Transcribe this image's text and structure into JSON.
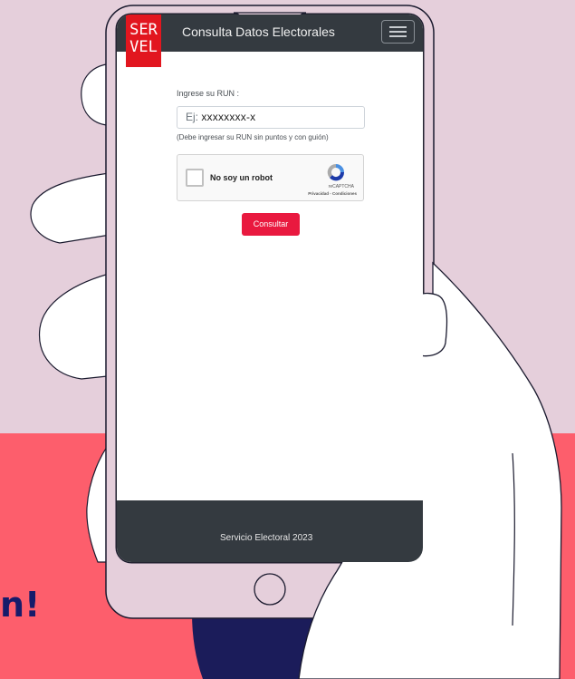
{
  "navbar": {
    "logo_line1": "SER",
    "logo_line2": "VEL",
    "title": "Consulta Datos Electorales",
    "menu_icon": "hamburger-menu-icon"
  },
  "form": {
    "run_label": "Ingrese su RUN :",
    "run_placeholder_prefix": "Ej:",
    "run_placeholder_example": "xxxxxxxx-x",
    "run_hint": "(Debe ingresar su RUN sin puntos y con guión)",
    "submit_label": "Consultar"
  },
  "captcha": {
    "checkbox_label": "No soy un robot",
    "brand": "reCAPTCHA",
    "links": "Privacidad - Condiciones",
    "icon": "recaptcha-icon"
  },
  "footer": {
    "text": "Servicio Electoral 2023"
  },
  "background": {
    "partial_heading": "n!"
  },
  "colors": {
    "background_top": "#e5cfdb",
    "background_bottom": "#fd5e6c",
    "navbar": "#343a40",
    "logo": "#e2161f",
    "button": "#e9193f",
    "heading": "#171b6a"
  }
}
